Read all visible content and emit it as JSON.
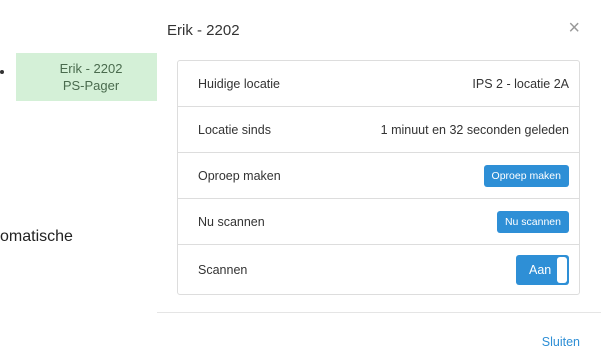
{
  "background": {
    "tag_line1": "Erik - 2202",
    "tag_line2": "PS-Pager",
    "partial_text": "omatische"
  },
  "modal": {
    "title": "Erik - 2202",
    "close_glyph": "×",
    "rows": [
      {
        "label": "Huidige locatie",
        "value": "IPS 2 - locatie 2A"
      },
      {
        "label": "Locatie sinds",
        "value": "1 minuut en 32 seconden geleden"
      },
      {
        "label": "Oproep maken",
        "button": "Oproep maken"
      },
      {
        "label": "Nu scannen",
        "button": "Nu scannen"
      },
      {
        "label": "Scannen",
        "toggle": "Aan",
        "toggle_on": true
      }
    ],
    "footer_link": "Sluiten"
  },
  "colors": {
    "primary": "#2e8fd6",
    "tag_bg": "#d4f0d7",
    "border": "#dddddd"
  }
}
